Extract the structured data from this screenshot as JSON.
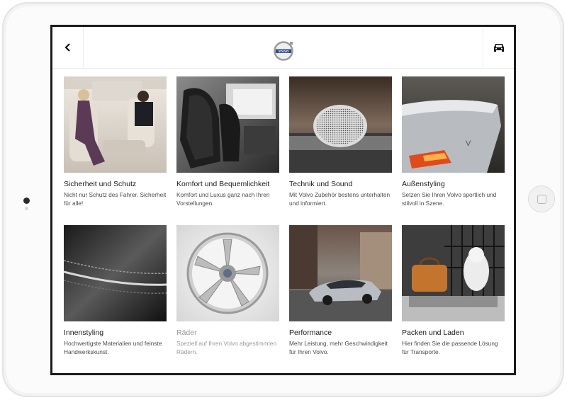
{
  "header": {
    "back_icon": "chevron-left-icon",
    "logo": "volvo-logo",
    "logo_text": "VOLVO",
    "car_icon": "car-icon"
  },
  "categories": [
    {
      "title": "Sicherheit und Schutz",
      "description": "Nicht nur Schutz des Fahrer. Sicherheit für alle!",
      "image": "car-interior-passengers"
    },
    {
      "title": "Komfort und Bequemlichkeit",
      "description": "Komfort und Luxus ganz nach Ihren Vorstellungen.",
      "image": "leather-seats"
    },
    {
      "title": "Technik und Sound",
      "description": "Mit Volvo Zubehör bestens unterhalten und informiert.",
      "image": "speaker-grille"
    },
    {
      "title": "Außenstyling",
      "description": "Setzen Sie Ihren Volvo sportlich und stilvoll in Szene.",
      "image": "tail-light"
    },
    {
      "title": "Innenstyling",
      "description": "Hochwertigste Materialien und feinste Handwerkskunst.",
      "image": "leather-stitching"
    },
    {
      "title": "Räder",
      "description": "Speziell auf Ihren Volvo abgestimmten Rädern.",
      "image": "alloy-wheel"
    },
    {
      "title": "Performance",
      "description": "Mehr Leistung, mehr Geschwindigkeit für Ihren Volvo.",
      "image": "concept-car"
    },
    {
      "title": "Packen und Laden",
      "description": "Hier finden Sie die passende Lösung für Transporte.",
      "image": "cargo-dog"
    }
  ]
}
